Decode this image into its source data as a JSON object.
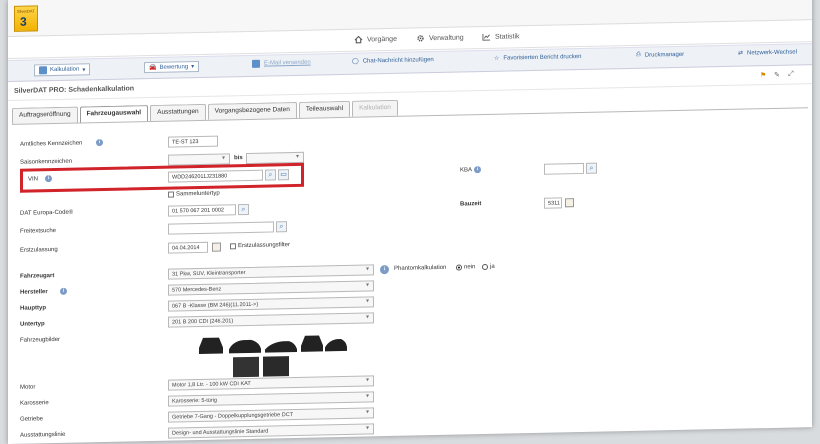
{
  "app": {
    "logo_line1": "SilverDAT",
    "logo_number": "3"
  },
  "mainnav": [
    {
      "label": "Vorgänge",
      "icon": "house-icon"
    },
    {
      "label": "Verwaltung",
      "icon": "gear-icon"
    },
    {
      "label": "Statistik",
      "icon": "chart-icon"
    }
  ],
  "toolbar": {
    "kalkulation": "Kalkulation",
    "bewertung": "Bewertung",
    "mail": "E-Mail versenden",
    "chat": "Chat-Nachricht hinzufügen",
    "favorites": "Favorisierten Bericht drucken",
    "print": "Druckmanager",
    "switch": "Netzwerk-Wechsel"
  },
  "page_title": "SilverDAT PRO: Schadenkalkulation",
  "tabs": [
    {
      "label": "Auftragseröffnung",
      "state": "normal"
    },
    {
      "label": "Fahrzeugauswahl",
      "state": "active"
    },
    {
      "label": "Ausstattungen",
      "state": "normal"
    },
    {
      "label": "Vorgangsbezogene Daten",
      "state": "normal"
    },
    {
      "label": "Teileauswahl",
      "state": "normal"
    },
    {
      "label": "Kalkulation",
      "state": "disabled"
    }
  ],
  "form": {
    "kennzeichen": {
      "label": "Amtliches Kennzeichen",
      "value": "TE-ST 123"
    },
    "saison": {
      "label": "Saisonkennzeichen",
      "bis": "bis"
    },
    "vin": {
      "label": "VIN",
      "value": "WDD2462011J231880"
    },
    "sammelunter": "Sammeluntertyp",
    "kba": {
      "label": "KBA"
    },
    "datcode": {
      "label": "DAT Europa-Code®",
      "value": "01 570 067 201 0002"
    },
    "baujahr": {
      "label": "Bauzeit",
      "value": "5311"
    },
    "freitext": {
      "label": "Freitextsuche"
    },
    "erstzulassung": {
      "label": "Erstzulassung",
      "value": "04.04.2014",
      "filter": "Erstzulassungsfilter"
    },
    "fahrzeugart": {
      "label": "Fahrzeugart",
      "value": "31 Pkw, SUV, Kleintransporter"
    },
    "phantom": {
      "label": "Phantomkalkulation",
      "nein": "nein",
      "ja": "ja"
    },
    "hersteller": {
      "label": "Hersteller",
      "value": "570 Mercedes-Benz"
    },
    "haupttyp": {
      "label": "Haupttyp",
      "value": "067 B -Klasse (BM 246)(11.2011->)"
    },
    "untertyp": {
      "label": "Untertyp",
      "value": "201 B 200 CDI (246.201)"
    },
    "bilder": {
      "label": "Fahrzeugbilder"
    },
    "motor": {
      "label": "Motor",
      "value": "Motor 1,8 Ltr. - 100 kW CDI KAT"
    },
    "karosserie": {
      "label": "Karosserie",
      "value": "Karosserie: 5-türig"
    },
    "getriebe": {
      "label": "Getriebe",
      "value": "Getriebe 7-Gang - Doppelkupplungsgetriebe DCT"
    },
    "ausstattungslinie": {
      "label": "Ausstattungslinie",
      "value": "Design- und Ausstattungslinie Standard"
    }
  },
  "colors": {
    "highlight": "#d1232a",
    "accent": "#2f5f9a"
  }
}
